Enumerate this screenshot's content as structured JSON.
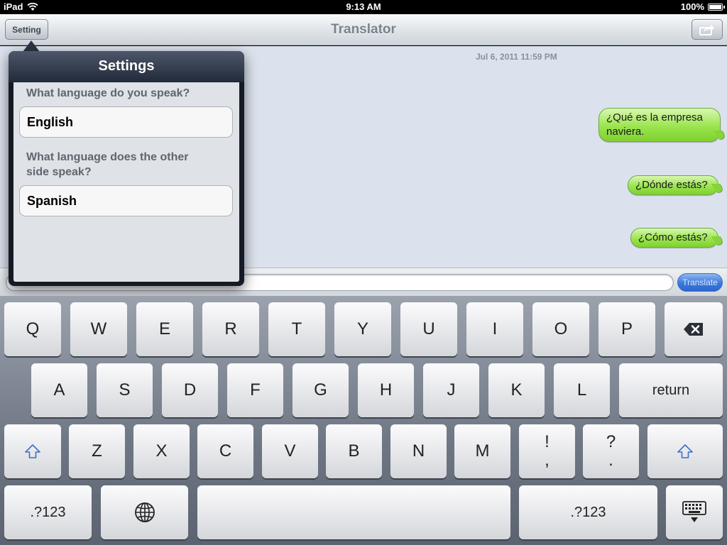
{
  "status_bar": {
    "device": "iPad",
    "time": "9:13 AM",
    "battery": "100%"
  },
  "nav_bar": {
    "title": "Translator",
    "setting_label": "Setting"
  },
  "chat": {
    "timestamp": "Jul 6, 2011 11:59 PM",
    "messages": [
      {
        "line1": "¿Qué es la empresa",
        "line2": "naviera."
      },
      {
        "text": "¿Dónde estás?"
      },
      {
        "text": "¿Cómo estás?"
      }
    ]
  },
  "input_bar": {
    "value": "",
    "translate_label": "Translate"
  },
  "popover": {
    "title": "Settings",
    "speak_question": "What language do you speak?",
    "speak_value": "English",
    "other_question_line1": "What language does the other",
    "other_question_line2": "side speak?",
    "other_value": "Spanish"
  },
  "keyboard": {
    "row1": [
      "Q",
      "W",
      "E",
      "R",
      "T",
      "Y",
      "U",
      "I",
      "O",
      "P"
    ],
    "row2": [
      "A",
      "S",
      "D",
      "F",
      "G",
      "H",
      "J",
      "K",
      "L"
    ],
    "return_label": "return",
    "row3": [
      "Z",
      "X",
      "C",
      "V",
      "B",
      "N",
      "M"
    ],
    "punct1": {
      "top": "!",
      "bottom": ","
    },
    "punct2": {
      "top": "?",
      "bottom": "."
    },
    "numbers_label": ".?123"
  },
  "colors": {
    "bubble_green": "#9be44f",
    "chat_bg": "#dbe2ed",
    "translate_blue": "#3a78de"
  },
  "icons": [
    "wifi-icon",
    "battery-icon",
    "share-icon",
    "backspace-icon",
    "shift-icon",
    "globe-icon",
    "keyboard-dismiss-icon"
  ]
}
